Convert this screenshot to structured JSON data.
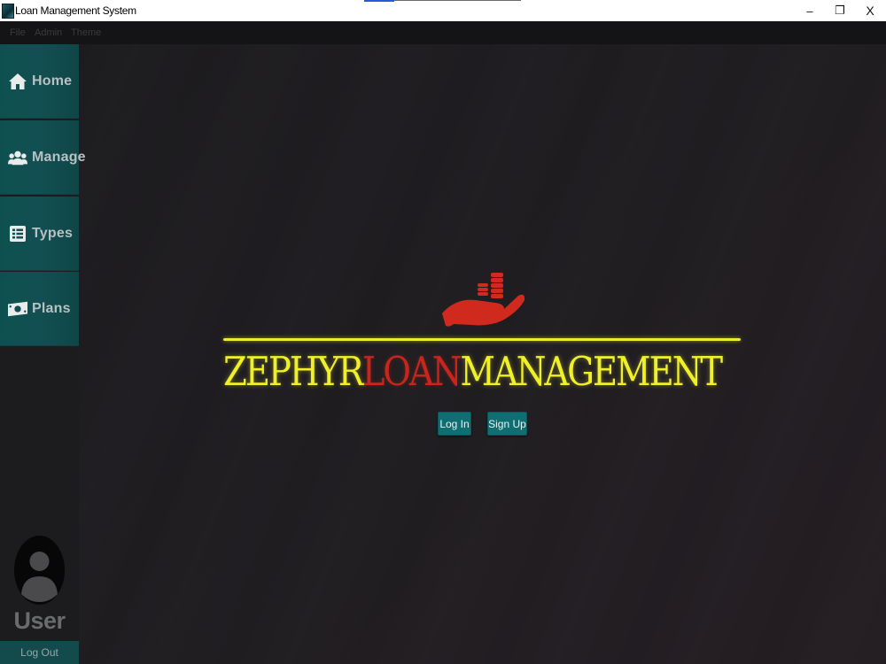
{
  "window": {
    "title": "Loan Management System",
    "controls": {
      "minimize": "–",
      "maximize": "❐",
      "close": "X"
    }
  },
  "menubar": {
    "items": [
      "File",
      "Admin",
      "Theme"
    ]
  },
  "sidebar": {
    "items": [
      {
        "label": "Home",
        "icon": "home-icon"
      },
      {
        "label": "Manage",
        "icon": "users-icon"
      },
      {
        "label": "Types",
        "icon": "list-icon"
      },
      {
        "label": "Plans",
        "icon": "money-icon"
      }
    ],
    "user_label": "User",
    "logout_label": "Log Out"
  },
  "logo": {
    "part1": "ZEPHYR",
    "part2": "LOAN",
    "part3": "MANAGEMENT",
    "icon": "hand-coins-icon"
  },
  "actions": {
    "login_label": "Log In",
    "signup_label": "Sign Up"
  },
  "colors": {
    "accent": "#0f6e72",
    "sidebar": "#124f52",
    "logo_yellow": "#f0f02a",
    "logo_red": "#c7261c"
  }
}
